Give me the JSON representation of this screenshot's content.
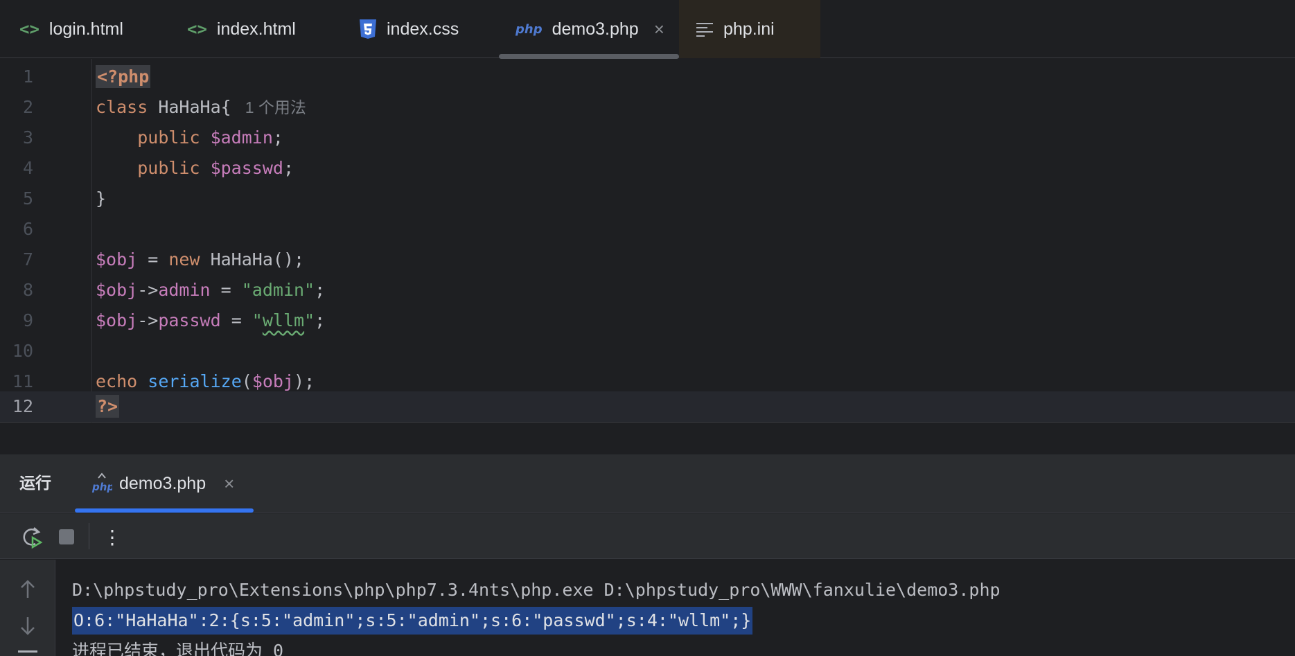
{
  "tabs": [
    {
      "label": "login.html",
      "icon": "html-tag-icon",
      "icon_text": "<>"
    },
    {
      "label": "index.html",
      "icon": "html-tag-icon",
      "icon_text": "<>"
    },
    {
      "label": "index.css",
      "icon": "css3-icon"
    },
    {
      "label": "demo3.php",
      "icon": "php-icon",
      "icon_text": "php",
      "active": true,
      "close": "×"
    },
    {
      "label": "php.ini",
      "icon": "text-lines-icon"
    }
  ],
  "editor": {
    "line_numbers": [
      "1",
      "2",
      "3",
      "4",
      "5",
      "6",
      "7",
      "8",
      "9",
      "10",
      "11",
      "12"
    ],
    "current_line": "12",
    "lines": {
      "l1": {
        "open_tag": "<?php"
      },
      "l2": {
        "kw": "class",
        "name": " HaHaHa{",
        "hint": "1 个用法"
      },
      "l3": {
        "indent": "    ",
        "kw": "public",
        "var": " $admin",
        "end": ";"
      },
      "l4": {
        "indent": "    ",
        "kw": "public",
        "var": " $passwd",
        "end": ";"
      },
      "l5": {
        "text": "}"
      },
      "l7": {
        "var": "$obj",
        "op": " = ",
        "kw": "new",
        "rest": " HaHaHa();"
      },
      "l8": {
        "var": "$obj",
        "arrow": "->",
        "prop": "admin",
        "op": " = ",
        "str": "\"admin\"",
        "end": ";"
      },
      "l9": {
        "var": "$obj",
        "arrow": "->",
        "prop": "passwd",
        "op": " = ",
        "q1": "\"",
        "str_squiggle": "wllm",
        "q2": "\"",
        "end": ";"
      },
      "l11": {
        "kw": "echo",
        "sp": " ",
        "fn": "serialize",
        "p1": "(",
        "var": "$obj",
        "p2": ");"
      },
      "l12": {
        "close_tag": "?>"
      }
    }
  },
  "run_panel": {
    "title": "运行",
    "tab_label": "demo3.php",
    "tab_icon_text": "php",
    "tab_close": "×",
    "more_icon": "⋮",
    "output": [
      "D:\\phpstudy_pro\\Extensions\\php\\php7.3.4nts\\php.exe D:\\phpstudy_pro\\WWW\\fanxulie\\demo3.php",
      "O:6:\"HaHaHa\":2:{s:5:\"admin\";s:5:\"admin\";s:6:\"passwd\";s:4:\"wllm\";}",
      "进程已结束，退出代码为 0"
    ]
  },
  "colors": {
    "background": "#1e1f22",
    "panel": "#2b2d30",
    "keyword": "#cf8e6d",
    "variable": "#c77dbb",
    "string": "#6aab73",
    "function": "#56a8f5",
    "selection": "#214283",
    "accent": "#3574f0"
  }
}
